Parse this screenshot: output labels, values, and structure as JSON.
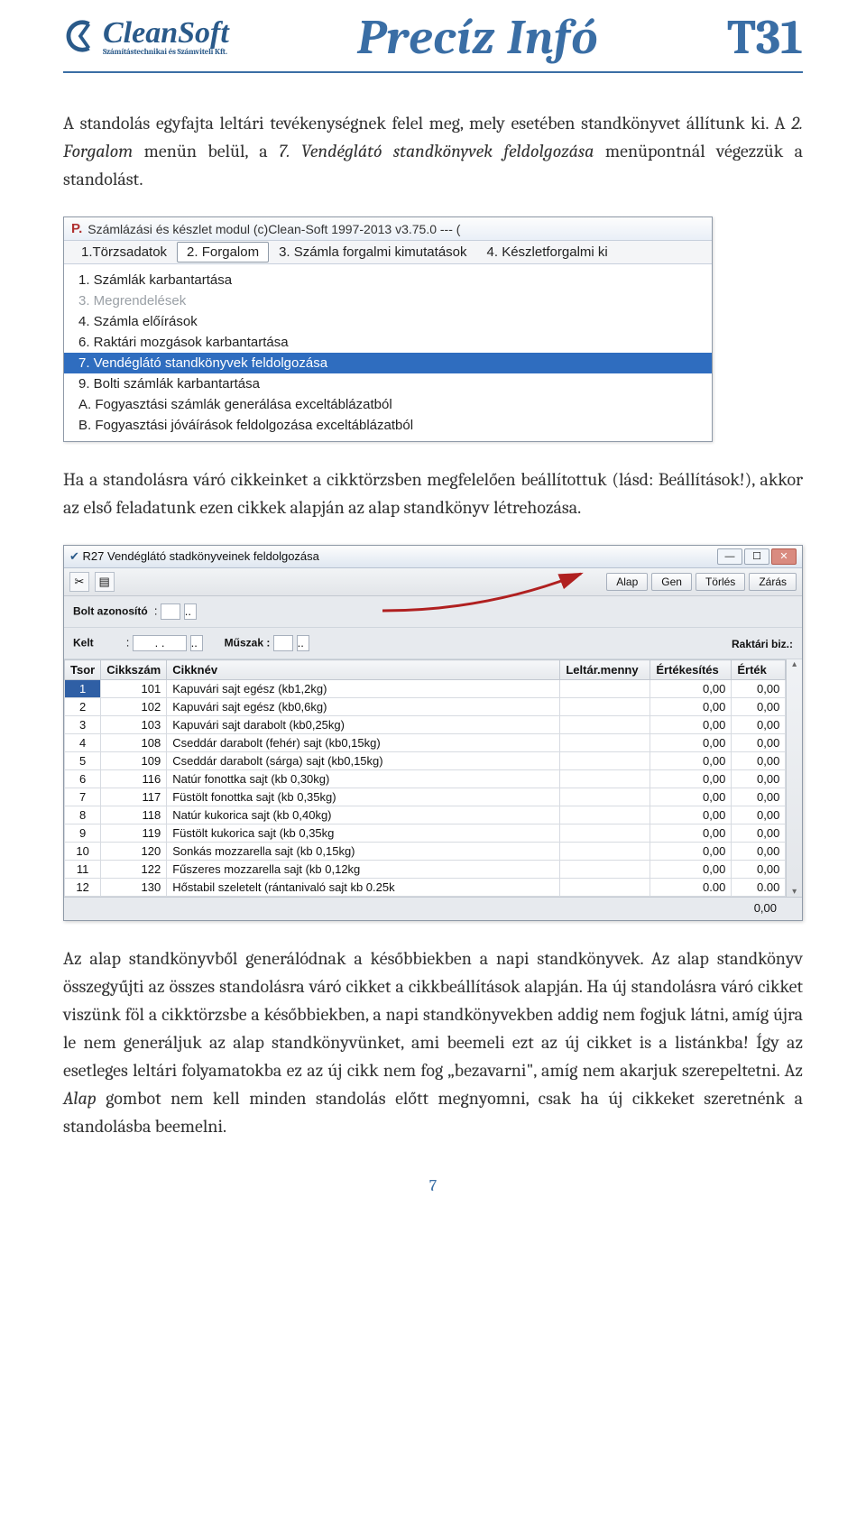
{
  "header": {
    "logo_name": "CleanSoft",
    "logo_sub": "Számítástechnikai és Számviteli Kft.",
    "title": "Precíz Infó",
    "code": "T31"
  },
  "para1_a": "A standolás egyfajta leltári tevékenységnek felel meg, mely esetében standkönyvet állítunk ki. A ",
  "para1_em1": "2. Forgalom",
  "para1_b": " menün belül, a ",
  "para1_em2": "7. Vendéglátó standkönyvek feldolgozása",
  "para1_c": " menüpontnál végezzük a standolást.",
  "win1": {
    "title": "Számlázási és készlet modul (c)Clean-Soft 1997-2013 v3.75.0  ---  (",
    "tabs": [
      "1.Törzsadatok",
      "2. Forgalom",
      "3. Számla forgalmi kimutatások",
      "4. Készletforgalmi ki"
    ],
    "active_tab_index": 1,
    "items": [
      {
        "t": "1. Számlák karbantartása",
        "dis": false
      },
      {
        "t": "3. Megrendelések",
        "dis": true
      },
      {
        "t": "4. Számla előírások",
        "dis": false
      },
      {
        "t": "6. Raktári mozgások karbantartása",
        "dis": false
      },
      {
        "t": "7. Vendéglátó standkönyvek feldolgozása",
        "dis": false,
        "sel": true
      },
      {
        "t": "9. Bolti számlák karbantartása",
        "dis": false
      },
      {
        "t": "A. Fogyasztási számlák generálása exceltáblázatból",
        "dis": false
      },
      {
        "t": "B. Fogyasztási jóváírások feldolgozása exceltáblázatból",
        "dis": false
      }
    ]
  },
  "para2": "Ha a standolásra váró cikkeinket a cikktörzsben megfelelően beállítottuk (lásd: Beállítások!), akkor az első feladatunk ezen cikkek alapján az alap standkönyv létrehozása.",
  "win2": {
    "title": "R27 Vendéglátó stadkönyveinek feldolgozása",
    "buttons": [
      "Alap",
      "Gen",
      "Törlés",
      "Zárás"
    ],
    "form": {
      "bolt_label": "Bolt azonosító",
      "bolt_val": "",
      "kelt_label": "Kelt",
      "kelt_val": ". .",
      "muszak_label": "Műszak :",
      "muszak_val": "",
      "raktari_label": "Raktári biz.:"
    },
    "columns": [
      "Tsor",
      "Cikkszám",
      "Cikknév",
      "Leltár.menny",
      "Értékesítés",
      "Érték"
    ],
    "rows": [
      {
        "t": "1",
        "cs": "101",
        "n": "Kapuvári sajt egész (kb1,2kg)",
        "lm": "",
        "e": "0,00",
        "v": "0,00",
        "sel": true
      },
      {
        "t": "2",
        "cs": "102",
        "n": "Kapuvári sajt egész (kb0,6kg)",
        "lm": "",
        "e": "0,00",
        "v": "0,00"
      },
      {
        "t": "3",
        "cs": "103",
        "n": "Kapuvári sajt darabolt (kb0,25kg)",
        "lm": "",
        "e": "0,00",
        "v": "0,00"
      },
      {
        "t": "4",
        "cs": "108",
        "n": "Cseddár darabolt (fehér) sajt (kb0,15kg)",
        "lm": "",
        "e": "0,00",
        "v": "0,00"
      },
      {
        "t": "5",
        "cs": "109",
        "n": "Cseddár darabolt (sárga) sajt (kb0,15kg)",
        "lm": "",
        "e": "0,00",
        "v": "0,00"
      },
      {
        "t": "6",
        "cs": "116",
        "n": "Natúr fonottka sajt (kb 0,30kg)",
        "lm": "",
        "e": "0,00",
        "v": "0,00"
      },
      {
        "t": "7",
        "cs": "117",
        "n": "Füstölt fonottka sajt (kb 0,35kg)",
        "lm": "",
        "e": "0,00",
        "v": "0,00"
      },
      {
        "t": "8",
        "cs": "118",
        "n": "Natúr kukorica sajt (kb 0,40kg)",
        "lm": "",
        "e": "0,00",
        "v": "0,00"
      },
      {
        "t": "9",
        "cs": "119",
        "n": "Füstölt kukorica sajt (kb 0,35kg",
        "lm": "",
        "e": "0,00",
        "v": "0,00"
      },
      {
        "t": "10",
        "cs": "120",
        "n": "Sonkás mozzarella sajt (kb 0,15kg)",
        "lm": "",
        "e": "0,00",
        "v": "0,00"
      },
      {
        "t": "11",
        "cs": "122",
        "n": "Fűszeres mozzarella sajt (kb 0,12kg",
        "lm": "",
        "e": "0,00",
        "v": "0,00"
      },
      {
        "t": "12",
        "cs": "130",
        "n": "Hőstabil szeletelt (rántanivaló sajt kb 0.25k",
        "lm": "",
        "e": "0.00",
        "v": "0.00"
      }
    ],
    "footer_total": "0,00"
  },
  "para3_a": "Az alap standkönyvből generálódnak a későbbiekben a napi standkönyvek. Az alap standkönyv összegyűjti az összes standolásra váró cikket a cikkbeállítások alapján. Ha új standolásra váró cikket viszünk föl a cikktörzsbe a későbbiekben, a napi standkönyvekben addig nem fogjuk látni, amíg újra le nem generáljuk az alap standkönyvünket, ami beemeli ezt az új cikket is a listánkba! Így az esetleges leltári folyamatokba ez az új cikk nem fog „bezavarni\", amíg nem akarjuk szerepeltetni. Az ",
  "para3_em": "Alap",
  "para3_b": " gombot nem kell minden standolás előtt megnyomni, csak ha új cikkeket szeretnénk a standolásba beemelni.",
  "page_number": "7"
}
